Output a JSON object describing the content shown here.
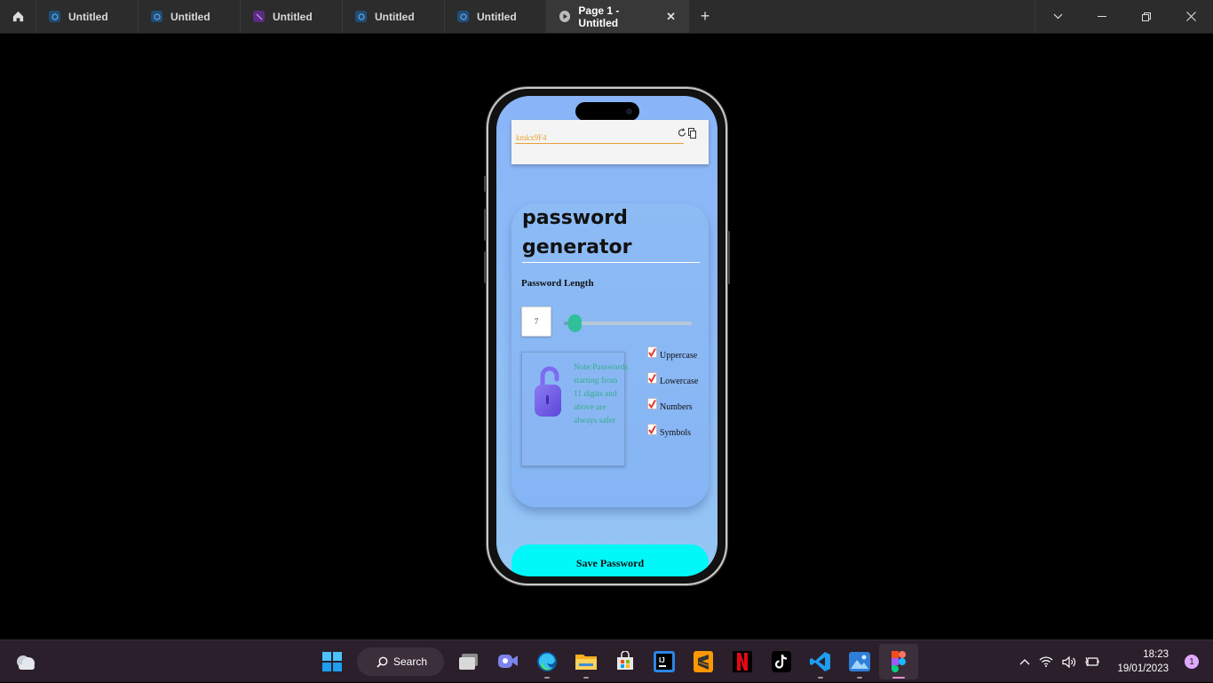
{
  "tabs": [
    {
      "label": "Untitled",
      "icon": "figjam-icon",
      "color": "#1f4e79"
    },
    {
      "label": "Untitled",
      "icon": "figjam-icon",
      "color": "#1f4e79"
    },
    {
      "label": "Untitled",
      "icon": "figjam-purple-icon",
      "color": "#5b2c83"
    },
    {
      "label": "Untitled",
      "icon": "figjam-icon",
      "color": "#1f4e79"
    },
    {
      "label": "Untitled",
      "icon": "figjam-icon",
      "color": "#1f4e79"
    }
  ],
  "active_tab": {
    "label": "Page 1 - Untitled",
    "icon": "play-icon"
  },
  "app": {
    "password_value": "kmkx9F4",
    "title_line1": "password",
    "title_line2": "generator",
    "length_label": "Password Length",
    "length_value": "7",
    "slider_level": 0.1,
    "note": "Note:Passwords starting from 11 digits and above are always safer",
    "options": [
      {
        "label": "Uppercase",
        "checked": true
      },
      {
        "label": "Lowercase",
        "checked": true
      },
      {
        "label": "Numbers",
        "checked": true
      },
      {
        "label": "Symbols",
        "checked": true
      }
    ],
    "save_label": "Save Password",
    "accent": "#00f8f8",
    "check_color": "#e53935"
  },
  "taskbar": {
    "search_label": "Search",
    "time": "18:23",
    "date": "19/01/2023",
    "notifications": "1"
  }
}
